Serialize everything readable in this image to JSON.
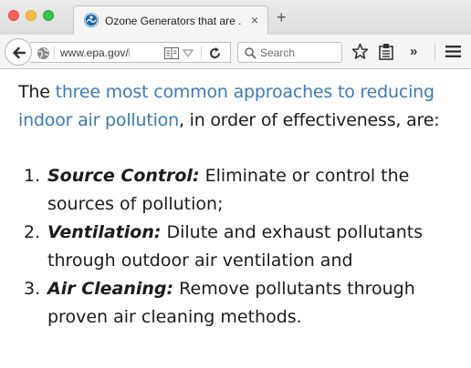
{
  "window": {
    "tab_title": "Ozone Generators that are ...",
    "tab_close": "×",
    "new_tab": "+"
  },
  "toolbar": {
    "url": "www.epa.gov/indo",
    "search_placeholder": "Search",
    "overflow": "»"
  },
  "article": {
    "intro_before": "The ",
    "intro_link": "three most common approaches to reducing indoor air pollution",
    "intro_after": ", in order of effectiveness, are:",
    "items": [
      {
        "number": "1.",
        "term": "Source Control:",
        "text": " Eliminate or control the sources of pollution;"
      },
      {
        "number": "2.",
        "term": "Ventilation:",
        "text": " Dilute and exhaust pollutants through outdoor air ventilation and"
      },
      {
        "number": "3.",
        "term": "Air Cleaning:",
        "text": " Remove pollutants through proven air cleaning methods."
      }
    ]
  },
  "colors": {
    "link": "#3b7ab8",
    "favicon": "#1e6aa8"
  },
  "icons": {
    "favicon": "epa-logo-icon",
    "back": "back-arrow-icon",
    "site_info": "globe-icon",
    "reader": "reader-view-icon",
    "reload": "reload-icon",
    "search": "search-icon",
    "bookmark": "star-icon",
    "reading_list": "reading-list-icon",
    "menu": "hamburger-menu-icon"
  }
}
